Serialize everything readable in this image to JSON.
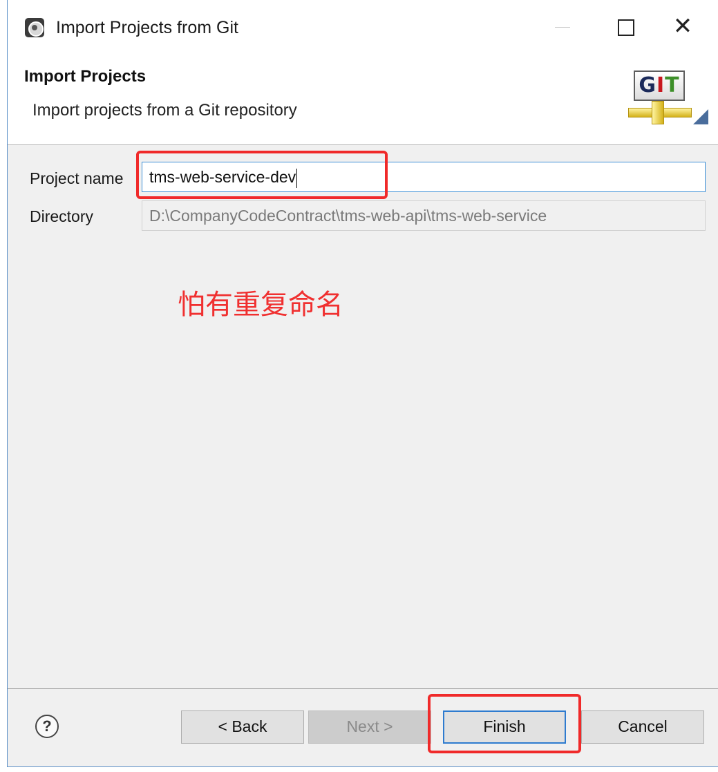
{
  "window": {
    "title": "Import Projects from Git",
    "close_glyph": "✕"
  },
  "header": {
    "title": "Import Projects",
    "description": "Import projects from a Git repository",
    "logo": {
      "letter_g": "G",
      "letter_i": "I",
      "letter_t": "T"
    }
  },
  "form": {
    "project_name_label": "Project name",
    "project_name_value": "tms-web-service-dev",
    "directory_label": "Directory",
    "directory_value": "D:\\CompanyCodeContract\\tms-web-api\\tms-web-service"
  },
  "annotation": {
    "text": "怕有重复命名",
    "color": "#f02a2a"
  },
  "footer": {
    "help_glyph": "?",
    "back_label": "< Back",
    "next_label": "Next >",
    "finish_label": "Finish",
    "cancel_label": "Cancel"
  },
  "colors": {
    "focus_border": "#3c8fd6",
    "dialog_background": "#f0f0f0"
  }
}
